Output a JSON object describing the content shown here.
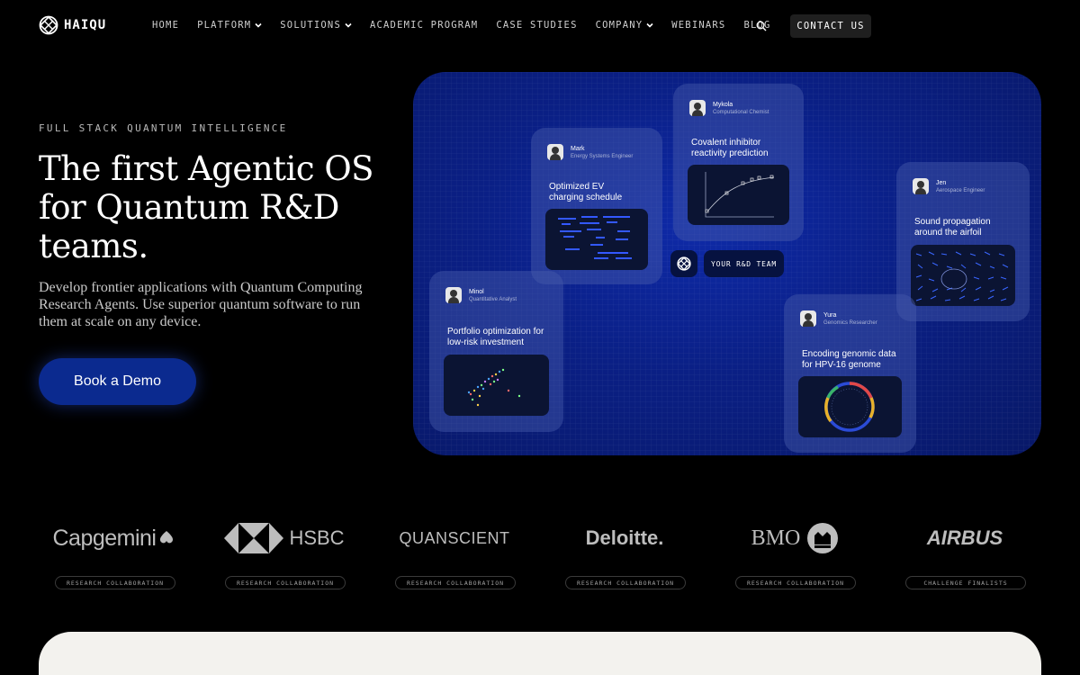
{
  "brand": {
    "name": "HAIQU"
  },
  "nav": {
    "items": [
      {
        "label": "HOME",
        "dropdown": false
      },
      {
        "label": "PLATFORM",
        "dropdown": true
      },
      {
        "label": "SOLUTIONS",
        "dropdown": true
      },
      {
        "label": "ACADEMIC PROGRAM",
        "dropdown": false
      },
      {
        "label": "CASE STUDIES",
        "dropdown": false
      },
      {
        "label": "COMPANY",
        "dropdown": true
      },
      {
        "label": "WEBINARS",
        "dropdown": false
      },
      {
        "label": "BLOG",
        "dropdown": false
      }
    ],
    "search_icon": "search-icon",
    "cta": "CONTACT US"
  },
  "hero": {
    "eyebrow": "FULL STACK QUANTUM INTELLIGENCE",
    "headline": "The first Agentic OS for Quantum R&D teams.",
    "subtext": "Develop frontier applications with Quantum Computing Research Agents. Use superior quantum software to run them at scale on any device.",
    "cta": "Book a Demo",
    "accent": "#0b2a8f"
  },
  "visual": {
    "center_label": "YOUR R&D TEAM",
    "cards": [
      {
        "id": "mark",
        "name": "Mark",
        "role": "Energy Systems Engineer",
        "title": "Optimized EV charging schedule"
      },
      {
        "id": "mykola",
        "name": "Mykola",
        "role": "Computational Chemist",
        "title": "Covalent inhibitor reactivity prediction"
      },
      {
        "id": "jen",
        "name": "Jen",
        "role": "Aerospace Engineer",
        "title": "Sound propagation around the airfoil"
      },
      {
        "id": "minol",
        "name": "Minol",
        "role": "Quantitative Analyst",
        "title": "Portfolio optimization for low-risk investment"
      },
      {
        "id": "yura",
        "name": "Yura",
        "role": "Genomics Researcher",
        "title": "Encoding genomic data for HPV-16 genome"
      }
    ]
  },
  "partners": [
    {
      "name": "Capgemini",
      "tag": "RESEARCH COLLABORATION"
    },
    {
      "name": "HSBC",
      "tag": "RESEARCH COLLABORATION"
    },
    {
      "name": "QUANSCIENT",
      "tag": "RESEARCH COLLABORATION"
    },
    {
      "name": "Deloitte.",
      "tag": "RESEARCH COLLABORATION"
    },
    {
      "name": "BMO",
      "tag": "RESEARCH COLLABORATION"
    },
    {
      "name": "AIRBUS",
      "tag": "CHALLENGE FINALISTS"
    }
  ]
}
